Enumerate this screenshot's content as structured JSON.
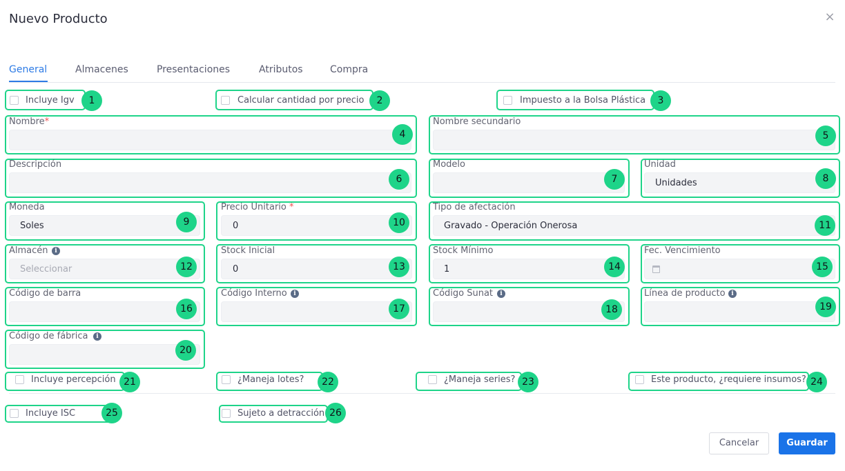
{
  "dialog": {
    "title": "Nuevo Producto",
    "close_icon": "×"
  },
  "tabs": [
    {
      "label": "General"
    },
    {
      "label": "Almacenes"
    },
    {
      "label": "Presentaciones"
    },
    {
      "label": "Atributos"
    },
    {
      "label": "Compra"
    }
  ],
  "checkboxes": {
    "incluye_igv": "Incluye Igv",
    "calcular_cantidad": "Calcular cantidad por precio",
    "impuesto_bolsa": "Impuesto a la Bolsa Plástica",
    "incluye_percepcion": "Incluye percepción",
    "maneja_lotes": "¿Maneja lotes?",
    "maneja_series": "¿Maneja series?",
    "requiere_insumos": "Este producto, ¿requiere insumos?",
    "incluye_isc": "Incluye ISC",
    "sujeto_detraccion": "Sujeto a detracción"
  },
  "fields": {
    "nombre": {
      "label": "Nombre",
      "required_mark": "*",
      "value": ""
    },
    "nombre_secundario": {
      "label": "Nombre secundario",
      "value": ""
    },
    "descripcion": {
      "label": "Descripción",
      "value": ""
    },
    "modelo": {
      "label": "Modelo",
      "value": ""
    },
    "unidad": {
      "label": "Unidad",
      "value": "Unidades"
    },
    "moneda": {
      "label": "Moneda",
      "value": "Soles"
    },
    "precio_unitario": {
      "label": "Precio Unitario",
      "required_mark": "*",
      "value": "0"
    },
    "tipo_afectacion": {
      "label": "Tipo de afectación",
      "value": "Gravado - Operación Onerosa"
    },
    "almacen": {
      "label": "Almacén",
      "placeholder": "Seleccionar"
    },
    "stock_inicial": {
      "label": "Stock Inicial",
      "value": "0"
    },
    "stock_minimo": {
      "label": "Stock Mínimo",
      "value": "1"
    },
    "fec_vencimiento": {
      "label": "Fec. Vencimiento",
      "value": ""
    },
    "codigo_barra": {
      "label": "Código de barra",
      "value": ""
    },
    "codigo_interno": {
      "label": "Código Interno",
      "value": ""
    },
    "codigo_sunat": {
      "label": "Código Sunat",
      "value": ""
    },
    "linea_producto": {
      "label": "Línea de producto",
      "value": ""
    },
    "codigo_fabrica": {
      "label": "Código de fábrica",
      "value": ""
    }
  },
  "badges": [
    "1",
    "2",
    "3",
    "4",
    "5",
    "6",
    "7",
    "8",
    "9",
    "10",
    "11",
    "12",
    "13",
    "14",
    "15",
    "16",
    "17",
    "18",
    "19",
    "20",
    "21",
    "22",
    "23",
    "24",
    "25",
    "26"
  ],
  "info_glyph": "i",
  "buttons": {
    "cancel": "Cancelar",
    "save": "Guardar"
  },
  "colors": {
    "accent": "#1a73e8",
    "tab_active": "#2d7be5",
    "highlight": "#1ed489",
    "required": "#f25050"
  }
}
